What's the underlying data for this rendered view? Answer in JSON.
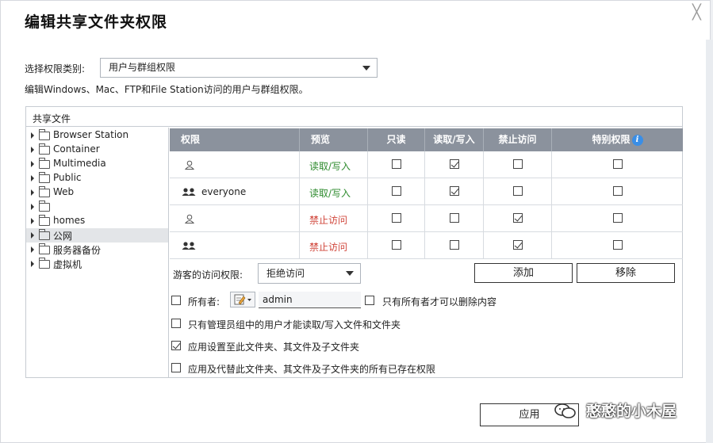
{
  "dialog": {
    "title": "编辑共享文件夹权限",
    "close_symbol": "╳"
  },
  "permission_type": {
    "label": "选择权限类别:",
    "selected": "用户与群组权限"
  },
  "description": "编辑Windows、Mac、FTP和File Station访问的用户与群组权限。",
  "panel": {
    "header": "共享文件"
  },
  "tree": {
    "items": [
      {
        "label": "Browser Station",
        "selected": false
      },
      {
        "label": "Container",
        "selected": false
      },
      {
        "label": "Multimedia",
        "selected": false
      },
      {
        "label": "Public",
        "selected": false
      },
      {
        "label": "Web",
        "selected": false
      },
      {
        "label": "",
        "selected": false
      },
      {
        "label": "homes",
        "selected": false
      },
      {
        "label": "公网",
        "selected": true
      },
      {
        "label": "服务器备份",
        "selected": false
      },
      {
        "label": "虚拟机",
        "selected": false
      }
    ]
  },
  "grid": {
    "headers": {
      "permission": "权限",
      "preview": "预览",
      "read_only": "只读",
      "read_write": "读取/写入",
      "deny": "禁止访问",
      "special": "特别权限",
      "info_symbol": "i"
    },
    "rows": [
      {
        "icon": "user-icon",
        "name": "",
        "preview": "读取/写入",
        "preview_kind": "rw",
        "read_only": false,
        "read_write": true,
        "deny": false,
        "special": false
      },
      {
        "icon": "group-icon",
        "name": "everyone",
        "preview": "读取/写入",
        "preview_kind": "rw",
        "read_only": false,
        "read_write": true,
        "deny": false,
        "special": false
      },
      {
        "icon": "user-icon",
        "name": "",
        "preview": "禁止访问",
        "preview_kind": "deny",
        "read_only": false,
        "read_write": false,
        "deny": true,
        "special": false
      },
      {
        "icon": "group-icon",
        "name": "",
        "preview": "禁止访问",
        "preview_kind": "deny",
        "read_only": false,
        "read_write": false,
        "deny": true,
        "special": false
      }
    ]
  },
  "guest": {
    "label": "游客的访问权限:",
    "selected": "拒绝访问"
  },
  "buttons": {
    "add": "添加",
    "remove": "移除",
    "apply": "应用"
  },
  "options": {
    "owner_label": "所有者:",
    "owner_checked": false,
    "owner_value": "admin",
    "owner_only_delete": "只有所有者才可以删除内容",
    "owner_only_delete_checked": false,
    "admin_group_only": "只有管理员组中的用户才能读取/写入文件和文件夹",
    "admin_group_only_checked": false,
    "apply_to_subfolders": "应用设置至此文件夹、其文件及子文件夹",
    "apply_to_subfolders_checked": true,
    "replace_existing": "应用及代替此文件夹、其文件及子文件夹的所有已存在权限",
    "replace_existing_checked": false
  },
  "watermark": "憨憨的小木屋"
}
